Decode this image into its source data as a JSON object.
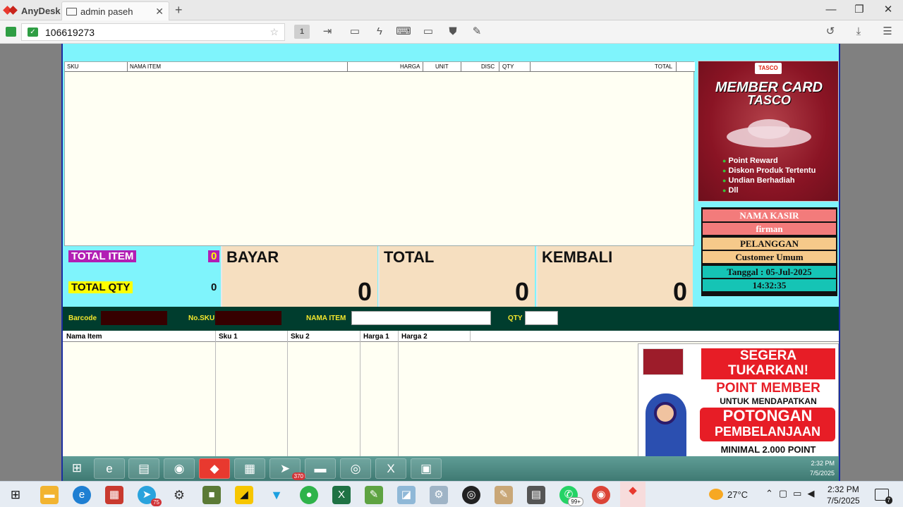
{
  "anydesk": {
    "brand": "AnyDesk",
    "tab_title": "admin paseh",
    "address": "106619273",
    "monitor_label": "1"
  },
  "pos": {
    "grid_headers": [
      "SKU",
      "NAMA ITEM",
      "HARGA",
      "UNIT",
      "DISC",
      "QTY",
      "TOTAL"
    ],
    "total_item_label": "TOTAL ITEM",
    "total_item_value": "0",
    "total_qty_label": "TOTAL QTY",
    "total_qty_value": "0",
    "bayar_label": "BAYAR",
    "bayar_value": "0",
    "total_label": "TOTAL",
    "total_value": "0",
    "kembali_label": "KEMBALI",
    "kembali_value": "0",
    "entry": {
      "barcode_label": "Barcode",
      "nosku_label": "No.SKU",
      "namaitem_label": "NAMA ITEM",
      "qty_label": "QTY"
    },
    "lower_headers": [
      "Nama Item",
      "Sku 1",
      "Sku 2",
      "Harga 1",
      "Harga 2"
    ],
    "kasir_title": "NAMA KASIR",
    "kasir_name": "firman",
    "pelanggan_title": "PELANGGAN",
    "pelanggan_name": "Customer Umum",
    "tanggal": "Tanggal : 05-Jul-2025",
    "jam": "14:32:35"
  },
  "promo_top": {
    "logo": "TASCO",
    "title1": "MEMBER CARD",
    "title2": "TASCO",
    "bullets": [
      "Point Reward",
      "Diskon Produk Tertentu",
      "Undian Berhadiah",
      "Dll"
    ]
  },
  "promo_bottom": {
    "line1": "SEGERA",
    "line2": "TUKARKAN!",
    "line3": "POINT MEMBER",
    "line4": "UNTUK MENDAPATKAN",
    "line5": "POTONGAN",
    "line6": "PEMBELANJAAN",
    "line7": "MINIMAL 2.000 POINT"
  },
  "remote_taskbar": {
    "time": "2:32 PM",
    "date": "7/5/2025",
    "telegram_badge": "370"
  },
  "local_taskbar": {
    "weather": "27°C",
    "time": "2:32 PM",
    "date": "7/5/2025",
    "chrome_badge": "75",
    "whatsapp_badge": "99+",
    "notif_count": "7"
  },
  "colors": {
    "app_bg": "#7ff4fc",
    "entry_bar": "#003d2e",
    "summary_box": "#f6dfc0",
    "accent_red": "#e71d26"
  }
}
